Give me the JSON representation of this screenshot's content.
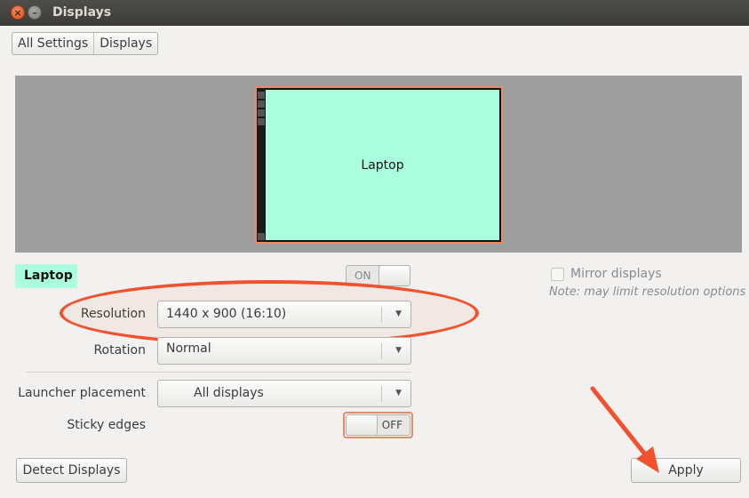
{
  "window": {
    "title": "Displays",
    "close_glyph": "×",
    "minimize_glyph": "–"
  },
  "breadcrumb": {
    "items": [
      "All Settings",
      "Displays"
    ]
  },
  "preview": {
    "monitor_label": "Laptop",
    "screen_color": "#aaffdf",
    "border_color": "#e88a67"
  },
  "display": {
    "name": "Laptop",
    "power_switch": "ON",
    "mirror_label": "Mirror displays",
    "mirror_note": "Note: may limit resolution options",
    "resolution_label": "Resolution",
    "resolution_value": "1440 x 900 (16:10)",
    "rotation_label": "Rotation",
    "rotation_value": "Normal",
    "launcher_label": "Launcher placement",
    "launcher_value": "All displays",
    "sticky_label": "Sticky edges",
    "sticky_switch": "OFF",
    "dropdown_glyph": "▼"
  },
  "footer": {
    "detect_label": "Detect Displays",
    "apply_label": "Apply"
  },
  "annotations": {
    "accent_color": "#f0522e"
  }
}
